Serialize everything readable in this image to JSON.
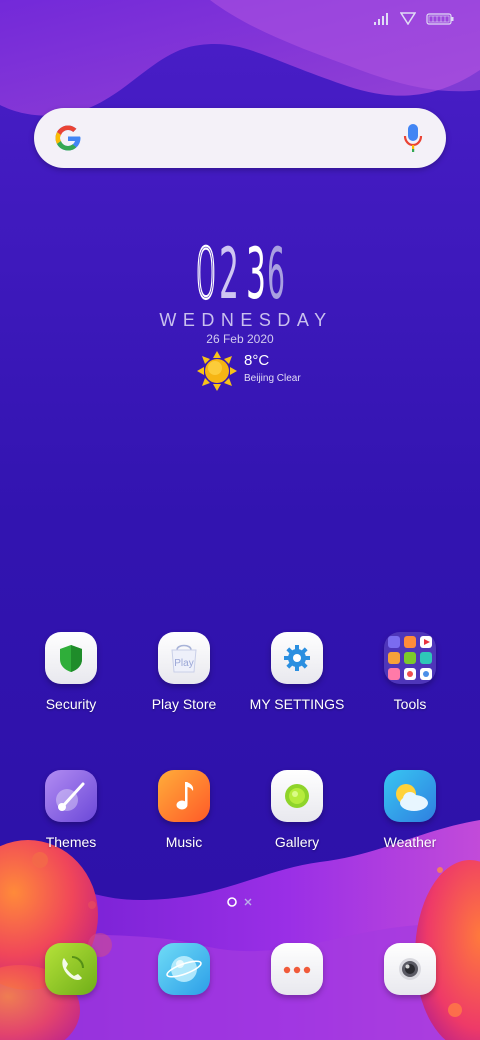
{
  "search": {
    "google_logo": "G",
    "mic_icon": "mic-icon"
  },
  "clock": {
    "h1": "0",
    "h2": "2",
    "m1": "3",
    "m2": "6",
    "weekday": "WEDNESDAY",
    "date": "26 Feb 2020"
  },
  "weather_widget": {
    "temp": "8°C",
    "location": "Beijing Clear",
    "icon": "sun-icon"
  },
  "apps_row1": [
    {
      "label": "Security",
      "icon": "shield-icon"
    },
    {
      "label": "Play Store",
      "icon": "shopping-bag-icon",
      "badge": "Play"
    },
    {
      "label": "MY SETTINGS",
      "icon": "gear-icon"
    },
    {
      "label": "Tools",
      "icon": "folder-grid-icon"
    }
  ],
  "apps_row2": [
    {
      "label": "Themes",
      "icon": "brush-icon"
    },
    {
      "label": "Music",
      "icon": "music-note-icon"
    },
    {
      "label": "Gallery",
      "icon": "gallery-icon"
    },
    {
      "label": "Weather",
      "icon": "weather-icon"
    }
  ],
  "dock": [
    {
      "icon": "phone-icon"
    },
    {
      "icon": "browser-icon"
    },
    {
      "icon": "messages-icon"
    },
    {
      "icon": "camera-icon"
    }
  ],
  "page_indicator": {
    "pages": 2,
    "current": 1
  },
  "colors": {
    "background": "#3a16b4",
    "accent_purple": "#8a2ee0",
    "accent_orange": "#f05a3a"
  }
}
